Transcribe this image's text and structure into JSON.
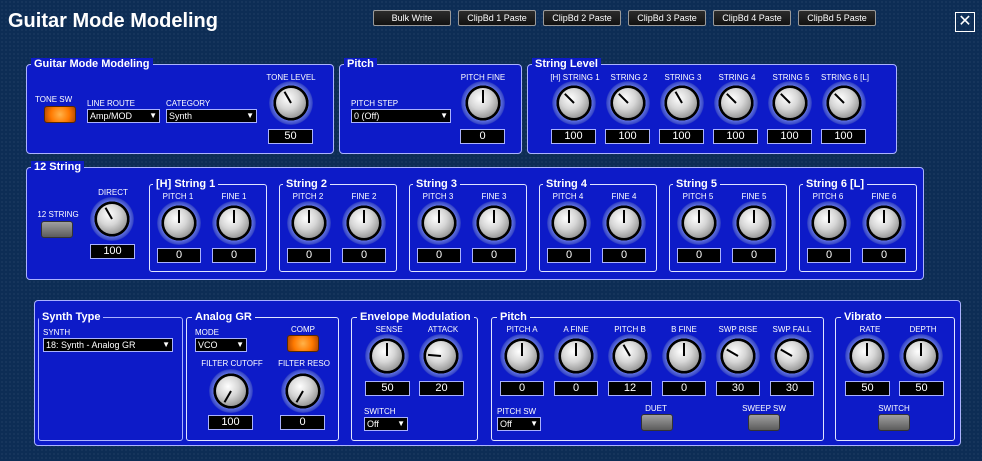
{
  "window": {
    "title": "Guitar Mode Modeling",
    "close": "✕"
  },
  "toolbar": [
    "Bulk Write",
    "ClipBd 1 Paste",
    "ClipBd 2 Paste",
    "ClipBd 3 Paste",
    "ClipBd 4 Paste",
    "ClipBd 5 Paste"
  ],
  "gmm": {
    "title": "Guitar Mode Modeling",
    "tone_sw": "TONE SW",
    "line_route": {
      "label": "LINE ROUTE",
      "value": "Amp/MOD"
    },
    "category": {
      "label": "CATEGORY",
      "value": "Synth"
    },
    "tone_level": {
      "label": "TONE LEVEL",
      "value": "50"
    }
  },
  "pitch1": {
    "title": "Pitch",
    "pitch_step": {
      "label": "PITCH STEP",
      "value": "0 (Off)"
    },
    "pitch_fine": {
      "label": "PITCH FINE",
      "value": "0"
    }
  },
  "string_level": {
    "title": "String Level",
    "items": [
      {
        "label": "[H] STRING 1",
        "value": "100"
      },
      {
        "label": "STRING 2",
        "value": "100"
      },
      {
        "label": "STRING 3",
        "value": "100"
      },
      {
        "label": "STRING 4",
        "value": "100"
      },
      {
        "label": "STRING 5",
        "value": "100"
      },
      {
        "label": "STRING 6 [L]",
        "value": "100"
      }
    ]
  },
  "twelve": {
    "title": "12 String",
    "switch_label": "12 STRING",
    "direct": {
      "label": "DIRECT",
      "value": "100"
    },
    "strings": [
      {
        "title": "[H] String 1",
        "pitch_label": "PITCH 1",
        "pitch": "0",
        "fine_label": "FINE 1",
        "fine": "0"
      },
      {
        "title": "String 2",
        "pitch_label": "PITCH 2",
        "pitch": "0",
        "fine_label": "FINE 2",
        "fine": "0"
      },
      {
        "title": "String 3",
        "pitch_label": "PITCH 3",
        "pitch": "0",
        "fine_label": "FINE 3",
        "fine": "0"
      },
      {
        "title": "String 4",
        "pitch_label": "PITCH 4",
        "pitch": "0",
        "fine_label": "FINE 4",
        "fine": "0"
      },
      {
        "title": "String 5",
        "pitch_label": "PITCH 5",
        "pitch": "0",
        "fine_label": "FINE 5",
        "fine": "0"
      },
      {
        "title": "String 6 [L]",
        "pitch_label": "PITCH 6",
        "pitch": "0",
        "fine_label": "FINE 6",
        "fine": "0"
      }
    ]
  },
  "synth": {
    "title": "Synth Type",
    "synth_label": "SYNTH",
    "synth_value": "18: Synth - Analog GR"
  },
  "analog": {
    "title": "Analog GR",
    "mode": {
      "label": "MODE",
      "value": "VCO"
    },
    "comp": "COMP",
    "filter_cutoff": {
      "label": "FILTER CUTOFF",
      "value": "100"
    },
    "filter_reso": {
      "label": "FILTER RESO",
      "value": "0"
    }
  },
  "env": {
    "title": "Envelope Modulation",
    "sense": {
      "label": "SENSE",
      "value": "50"
    },
    "attack": {
      "label": "ATTACK",
      "value": "20"
    },
    "switch": {
      "label": "SWITCH",
      "value": "Off"
    }
  },
  "pitch2": {
    "title": "Pitch",
    "knobs": [
      {
        "label": "PITCH A",
        "value": "0"
      },
      {
        "label": "A FINE",
        "value": "0"
      },
      {
        "label": "PITCH B",
        "value": "12"
      },
      {
        "label": "B FINE",
        "value": "0"
      },
      {
        "label": "SWP RISE",
        "value": "30"
      },
      {
        "label": "SWP FALL",
        "value": "30"
      }
    ],
    "pitch_sw": {
      "label": "PITCH SW",
      "value": "Off"
    },
    "duet": "DUET",
    "sweep_sw": "SWEEP SW"
  },
  "vibrato": {
    "title": "Vibrato",
    "rate": {
      "label": "RATE",
      "value": "50"
    },
    "depth": {
      "label": "DEPTH",
      "value": "50"
    },
    "switch": "SWITCH"
  },
  "colors": {
    "panel": "#0d1bc8",
    "background": "#0d2d55",
    "led_on": "#ff7a00"
  },
  "icons": {
    "close": "close-icon",
    "dropdown": "chevron-down-icon"
  }
}
